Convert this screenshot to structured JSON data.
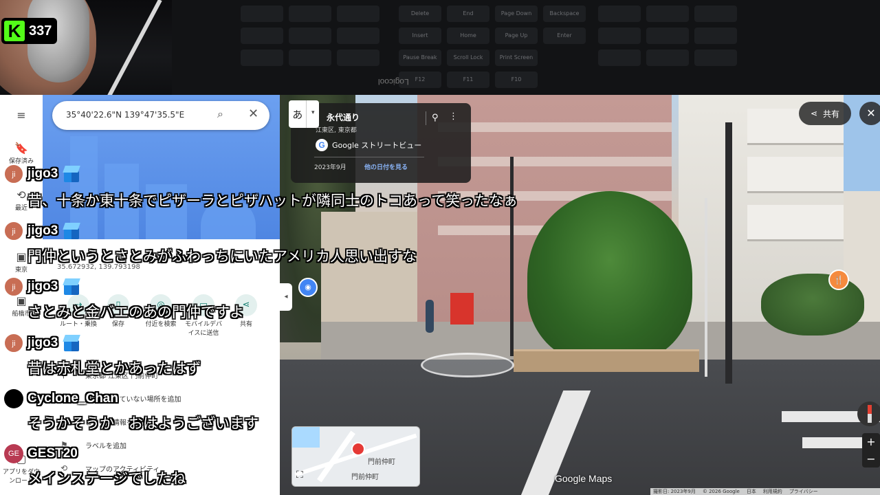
{
  "stream": {
    "counter_logo": "K",
    "viewer_count": "337",
    "keyboard_brand": "Logicool",
    "keyboard_keys": [
      "Delete",
      "End",
      "Page Down",
      "Insert",
      "Home",
      "Page Up",
      "Pause Break",
      "Scroll Lock",
      "Print Screen",
      "F12",
      "F11",
      "F10",
      "Enter",
      "Backspace"
    ]
  },
  "maps_panel": {
    "search_value": "35°40'22.6\"N 139°47'35.5\"E",
    "coordinates": "35.672932, 139.793198",
    "rail": {
      "menu_icon": "≡",
      "saved_label": "保存済み",
      "recent_label": "最近",
      "tokyo_label": "東京",
      "funabashi_label": "船橋市",
      "apps_label": "アプリをダウンロード"
    },
    "actions": [
      {
        "label": "ルート・乗換",
        "icon": "route-icon"
      },
      {
        "label": "保存",
        "icon": "bookmark-icon"
      },
      {
        "label": "付近を検索",
        "icon": "nearby-icon"
      },
      {
        "label": "モバイルデバイスに送信",
        "icon": "phone-icon"
      },
      {
        "label": "共有",
        "icon": "share-icon"
      }
    ],
    "rows": [
      {
        "label": "東京都 江東区 門前仲町",
        "icon": "pin-icon"
      },
      {
        "label": "地図に載っていない場所を追加",
        "icon": "add-place-icon"
      },
      {
        "label": "ビジネス情報を追加",
        "icon": "business-icon"
      },
      {
        "label": "ラベルを追加",
        "icon": "label-icon"
      },
      {
        "label": "マップのアクティビティ",
        "icon": "history-icon"
      }
    ]
  },
  "street_view": {
    "ime_char": "あ",
    "road_title": "永代通り",
    "address": "江東区, 東京都",
    "brand": "Google ストリートビュー",
    "capture_date": "2023年9月",
    "other_dates": "他の日付を見る",
    "share_label": "共有",
    "google_maps_logo": "Google Maps",
    "minimap_labels": [
      "門前仲町",
      "門前仲町"
    ],
    "footer": [
      "撮影日: 2023年9月",
      "© 2026 Google",
      "日本",
      "利用規約",
      "プライバシー"
    ]
  },
  "chat": [
    {
      "author": "jigo3",
      "avatar": "ji",
      "badge": true,
      "message": "昔、十条か東十条でピザーラとピザハットが隣同士のトコあって笑ったなぁ"
    },
    {
      "author": "jigo3",
      "avatar": "ji",
      "badge": true,
      "message": "門仲というとさとみがふわっちにいたアメリカ人思い出すな"
    },
    {
      "author": "jigo3",
      "avatar": "ji",
      "badge": true,
      "message": "さとみと金バエのあの門仲ですよ"
    },
    {
      "author": "jigo3",
      "avatar": "ji",
      "badge": true,
      "message": "昔は赤札堂とかあったはず"
    },
    {
      "author": "Cyclone_Chan",
      "avatar": "",
      "badge": false,
      "message": "そうかそうか　おはようございます"
    },
    {
      "author": "GEST20",
      "avatar": "GE",
      "badge": false,
      "message": "メインステージでしたね"
    }
  ],
  "colors": {
    "kick_green": "#53fc18",
    "maps_blue": "#4f86e2",
    "teal_action": "#188072"
  }
}
